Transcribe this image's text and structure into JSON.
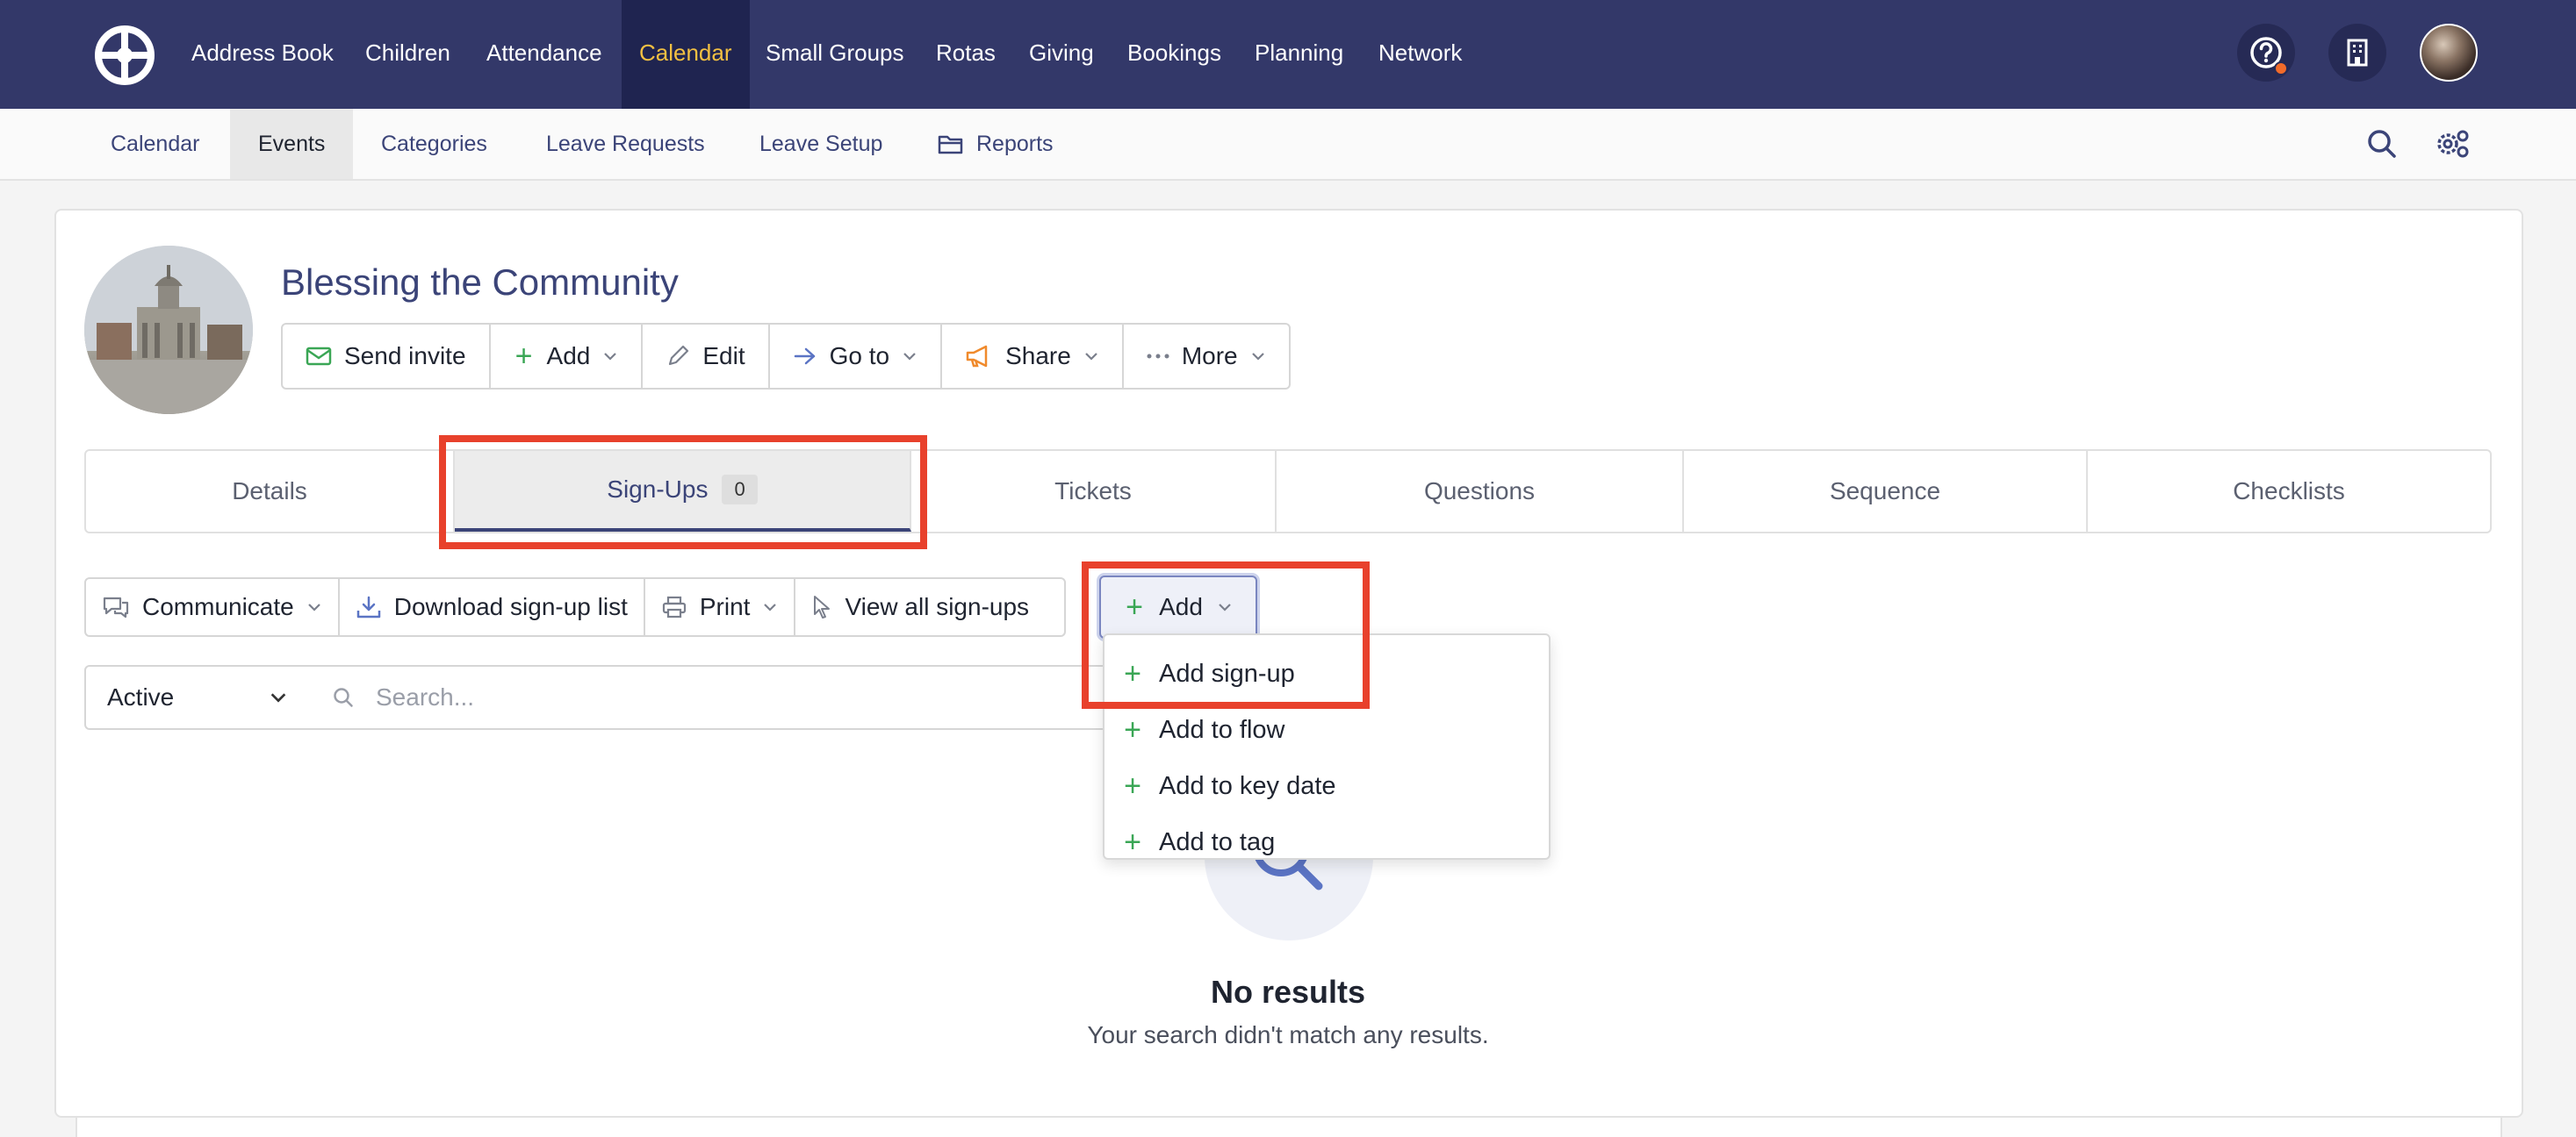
{
  "topnav": {
    "items": [
      "Address Book",
      "Children",
      "Attendance",
      "Calendar",
      "Small Groups",
      "Rotas",
      "Giving",
      "Bookings",
      "Planning",
      "Network"
    ],
    "active": "Calendar",
    "icons": [
      "help-icon",
      "building-icon",
      "user-avatar"
    ],
    "colors": {
      "bar": "#333869",
      "active_bg": "#1f2450",
      "active_text": "#f2c042"
    }
  },
  "subnav": {
    "items": [
      "Calendar",
      "Events",
      "Categories",
      "Leave Requests",
      "Leave Setup",
      "Reports"
    ],
    "active": "Events",
    "icons": [
      "folder-icon",
      "search-icon",
      "settings-icon"
    ]
  },
  "event": {
    "title": "Blessing the Community",
    "toolbar": [
      "Send invite",
      "Add",
      "Edit",
      "Go to",
      "Share",
      "More"
    ]
  },
  "tabs": {
    "items": [
      "Details",
      "Sign-Ups",
      "Tickets",
      "Questions",
      "Sequence",
      "Checklists"
    ],
    "active": "Sign-Ups",
    "signups_count": "0"
  },
  "actions": [
    "Communicate",
    "Download sign-up list",
    "Print",
    "View all sign-ups",
    "Add"
  ],
  "filter": {
    "status": "Active",
    "search_placeholder": "Search..."
  },
  "dropdown": {
    "items": [
      "Add sign-up",
      "Add to flow",
      "Add to key date",
      "Add to tag"
    ]
  },
  "empty": {
    "title": "No results",
    "subtitle": "Your search didn't match any results."
  },
  "highlight_color": "#e8412c"
}
